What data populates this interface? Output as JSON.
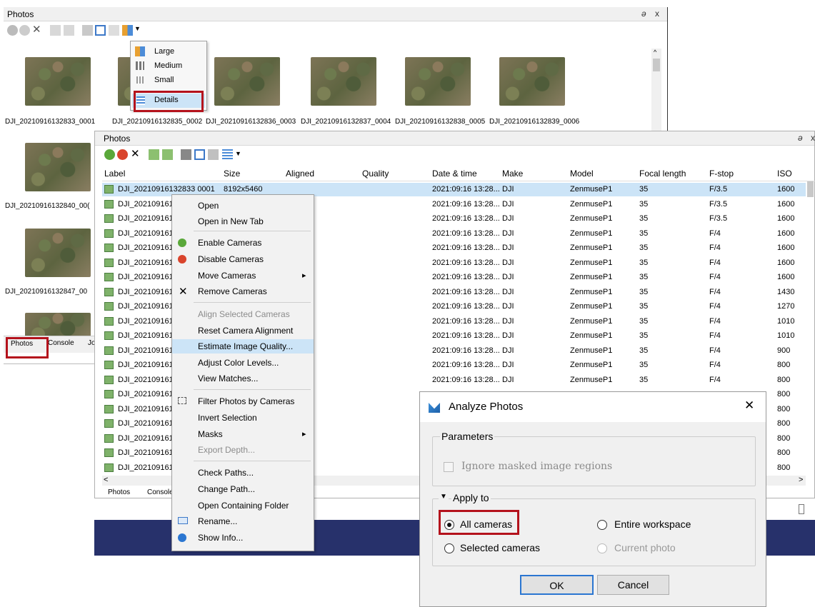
{
  "back_panel": {
    "title": "Photos",
    "ctrl_float": "ə",
    "ctrl_close": "x",
    "view_menu": {
      "items": [
        {
          "label": "Large",
          "icon": "large-grid-icon"
        },
        {
          "label": "Medium",
          "icon": "medium-grid-icon"
        },
        {
          "label": "Small",
          "icon": "small-grid-icon"
        },
        {
          "label": "Details",
          "icon": "details-list-icon"
        }
      ]
    },
    "thumb_row1": [
      "DJI_20210916132833_0001",
      "DJI_20210916132835_0002",
      "DJI_20210916132836_0003",
      "DJI_20210916132837_0004",
      "DJI_20210916132838_0005",
      "DJI_20210916132839_0006"
    ],
    "thumb_col": [
      "DJI_20210916132840_00(",
      "DJI_20210916132847_00"
    ],
    "tabs": {
      "photos": "Photos",
      "console": "Console",
      "j": "Jo"
    }
  },
  "front_panel": {
    "title": "Photos",
    "ctrl_float": "ə",
    "ctrl_close": "x",
    "columns": [
      "Label",
      "Size",
      "Aligned",
      "Quality",
      "Date & time",
      "Make",
      "Model",
      "Focal length",
      "F-stop",
      "ISO"
    ],
    "rows": [
      {
        "label": "DJI_20210916132833 0001",
        "size": "8192x5460",
        "date": "2021:09:16 13:28...",
        "make": "DJI",
        "model": "ZenmuseP1",
        "focal": "35",
        "fstop": "F/3.5",
        "iso": "1600"
      },
      {
        "label": "DJI_2021091613",
        "size": "",
        "date": "2021:09:16 13:28...",
        "make": "DJI",
        "model": "ZenmuseP1",
        "focal": "35",
        "fstop": "F/3.5",
        "iso": "1600"
      },
      {
        "label": "DJI_2021091613",
        "size": "",
        "date": "2021:09:16 13:28...",
        "make": "DJI",
        "model": "ZenmuseP1",
        "focal": "35",
        "fstop": "F/3.5",
        "iso": "1600"
      },
      {
        "label": "DJI_2021091613",
        "size": "",
        "date": "2021:09:16 13:28...",
        "make": "DJI",
        "model": "ZenmuseP1",
        "focal": "35",
        "fstop": "F/4",
        "iso": "1600"
      },
      {
        "label": "DJI_2021091613",
        "size": "",
        "date": "2021:09:16 13:28...",
        "make": "DJI",
        "model": "ZenmuseP1",
        "focal": "35",
        "fstop": "F/4",
        "iso": "1600"
      },
      {
        "label": "DJI_2021091613",
        "size": "",
        "date": "2021:09:16 13:28...",
        "make": "DJI",
        "model": "ZenmuseP1",
        "focal": "35",
        "fstop": "F/4",
        "iso": "1600"
      },
      {
        "label": "DJI_2021091613",
        "size": "",
        "date": "2021:09:16 13:28...",
        "make": "DJI",
        "model": "ZenmuseP1",
        "focal": "35",
        "fstop": "F/4",
        "iso": "1600"
      },
      {
        "label": "DJI_2021091613",
        "size": "",
        "date": "2021:09:16 13:28...",
        "make": "DJI",
        "model": "ZenmuseP1",
        "focal": "35",
        "fstop": "F/4",
        "iso": "1430"
      },
      {
        "label": "DJI_2021091613",
        "size": "",
        "date": "2021:09:16 13:28...",
        "make": "DJI",
        "model": "ZenmuseP1",
        "focal": "35",
        "fstop": "F/4",
        "iso": "1270"
      },
      {
        "label": "DJI_2021091613",
        "size": "",
        "date": "2021:09:16 13:28...",
        "make": "DJI",
        "model": "ZenmuseP1",
        "focal": "35",
        "fstop": "F/4",
        "iso": "1010"
      },
      {
        "label": "DJI_2021091613",
        "size": "",
        "date": "2021:09:16 13:28...",
        "make": "DJI",
        "model": "ZenmuseP1",
        "focal": "35",
        "fstop": "F/4",
        "iso": "1010"
      },
      {
        "label": "DJI_2021091613",
        "size": "",
        "date": "2021:09:16 13:28...",
        "make": "DJI",
        "model": "ZenmuseP1",
        "focal": "35",
        "fstop": "F/4",
        "iso": "900"
      },
      {
        "label": "DJI_2021091613",
        "size": "",
        "date": "2021:09:16 13:28...",
        "make": "DJI",
        "model": "ZenmuseP1",
        "focal": "35",
        "fstop": "F/4",
        "iso": "800"
      },
      {
        "label": "DJI_2021091613",
        "size": "",
        "date": "2021:09:16 13:28...",
        "make": "DJI",
        "model": "ZenmuseP1",
        "focal": "35",
        "fstop": "F/4",
        "iso": "800"
      },
      {
        "label": "DJI_2021091613",
        "size": "",
        "date": "",
        "make": "",
        "model": "",
        "focal": "",
        "fstop": "",
        "iso": "800"
      },
      {
        "label": "DJI_2021091613",
        "size": "",
        "date": "",
        "make": "",
        "model": "",
        "focal": "",
        "fstop": "",
        "iso": "800"
      },
      {
        "label": "DJI_2021091613",
        "size": "",
        "date": "",
        "make": "",
        "model": "",
        "focal": "",
        "fstop": "",
        "iso": "800"
      },
      {
        "label": "DJI_2021091613",
        "size": "",
        "date": "",
        "make": "",
        "model": "",
        "focal": "",
        "fstop": "",
        "iso": "800"
      },
      {
        "label": "DJI_2021091613",
        "size": "",
        "date": "",
        "make": "",
        "model": "",
        "focal": "",
        "fstop": "",
        "iso": "800"
      },
      {
        "label": "DJI_2021091613",
        "size": "",
        "date": "",
        "make": "",
        "model": "",
        "focal": "",
        "fstop": "",
        "iso": "800"
      }
    ],
    "tabs": {
      "photos": "Photos",
      "console": "Console"
    }
  },
  "context_menu": {
    "items": [
      {
        "label": "Open",
        "icon": ""
      },
      {
        "label": "Open in New Tab",
        "icon": ""
      },
      {
        "label": "Enable Cameras",
        "icon": "enable-icon"
      },
      {
        "label": "Disable Cameras",
        "icon": "disable-icon"
      },
      {
        "label": "Move Cameras",
        "icon": "",
        "submenu": true
      },
      {
        "label": "Remove Cameras",
        "icon": "remove-icon"
      },
      {
        "label": "Align Selected Cameras",
        "icon": "",
        "disabled": true
      },
      {
        "label": "Reset Camera Alignment",
        "icon": ""
      },
      {
        "label": "Estimate Image Quality...",
        "icon": "",
        "highlighted": true
      },
      {
        "label": "Adjust Color Levels...",
        "icon": ""
      },
      {
        "label": "View Matches...",
        "icon": ""
      },
      {
        "label": "Filter Photos by Cameras",
        "icon": "filter-icon"
      },
      {
        "label": "Invert Selection",
        "icon": ""
      },
      {
        "label": "Masks",
        "icon": "",
        "submenu": true
      },
      {
        "label": "Export Depth...",
        "icon": "",
        "disabled": true
      },
      {
        "label": "Check Paths...",
        "icon": ""
      },
      {
        "label": "Change Path...",
        "icon": ""
      },
      {
        "label": "Open Containing Folder",
        "icon": ""
      },
      {
        "label": "Rename...",
        "icon": "rename-icon"
      },
      {
        "label": "Show Info...",
        "icon": "info-icon"
      }
    ]
  },
  "dialog": {
    "title": "Analyze Photos",
    "close": "✕",
    "parameters_legend": "Parameters",
    "ignore_masked": "Ignore masked image regions",
    "apply_legend": "Apply to",
    "all_cameras": "All cameras",
    "entire_workspace": "Entire workspace",
    "selected_cameras": "Selected cameras",
    "current_photo": "Current photo",
    "ok": "OK",
    "cancel": "Cancel"
  },
  "colors": {
    "highlight_red": "#b4121c",
    "selection_blue": "#cce4f7",
    "taskbar": "#27316b"
  }
}
